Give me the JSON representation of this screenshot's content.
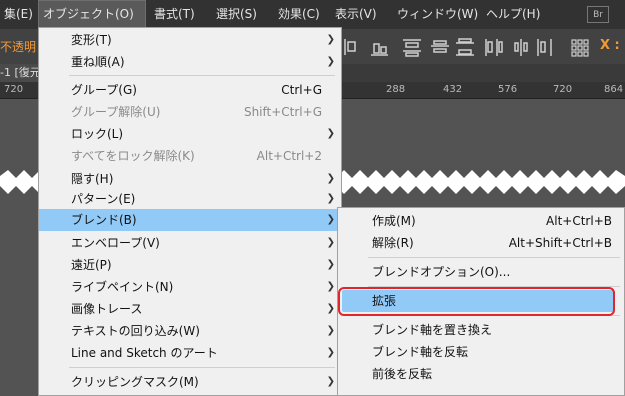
{
  "menubar": {
    "items": [
      {
        "label": "集(E)"
      },
      {
        "label": "オブジェクト(O)"
      },
      {
        "label": "書式(T)"
      },
      {
        "label": "選択(S)"
      },
      {
        "label": "効果(C)"
      },
      {
        "label": "表示(V)"
      },
      {
        "label": "ウィンドウ(W)"
      },
      {
        "label": "ヘルプ(H)"
      }
    ],
    "bridge_label": "Br"
  },
  "toolbar": {
    "opacity_label": "不透明",
    "x_label": "X :"
  },
  "doc_tab": {
    "label": "-1 [復元"
  },
  "ruler": {
    "ticks": [
      "720",
      "288",
      "432",
      "576",
      "720",
      "864"
    ]
  },
  "object_menu": {
    "items": [
      {
        "label": "変形(T)",
        "shortcut": "",
        "submenu": true,
        "disabled": false
      },
      {
        "label": "重ね順(A)",
        "shortcut": "",
        "submenu": true,
        "disabled": false
      },
      {
        "label": "グループ(G)",
        "shortcut": "Ctrl+G",
        "submenu": false,
        "disabled": false
      },
      {
        "label": "グループ解除(U)",
        "shortcut": "Shift+Ctrl+G",
        "submenu": false,
        "disabled": true
      },
      {
        "label": "ロック(L)",
        "shortcut": "",
        "submenu": true,
        "disabled": false
      },
      {
        "label": "すべてをロック解除(K)",
        "shortcut": "Alt+Ctrl+2",
        "submenu": false,
        "disabled": true
      },
      {
        "label": "隠す(H)",
        "shortcut": "",
        "submenu": true,
        "disabled": false
      },
      {
        "label": "パターン(E)",
        "shortcut": "",
        "submenu": true,
        "disabled": false
      },
      {
        "label": "ブレンド(B)",
        "shortcut": "",
        "submenu": true,
        "disabled": false
      },
      {
        "label": "エンベロープ(V)",
        "shortcut": "",
        "submenu": true,
        "disabled": false
      },
      {
        "label": "遠近(P)",
        "shortcut": "",
        "submenu": true,
        "disabled": false
      },
      {
        "label": "ライブペイント(N)",
        "shortcut": "",
        "submenu": true,
        "disabled": false
      },
      {
        "label": "画像トレース",
        "shortcut": "",
        "submenu": true,
        "disabled": false
      },
      {
        "label": "テキストの回り込み(W)",
        "shortcut": "",
        "submenu": true,
        "disabled": false
      },
      {
        "label": "Line and Sketch のアート",
        "shortcut": "",
        "submenu": true,
        "disabled": false
      },
      {
        "label": "クリッピングマスク(M)",
        "shortcut": "",
        "submenu": true,
        "disabled": false
      }
    ]
  },
  "blend_submenu": {
    "items": [
      {
        "label": "作成(M)",
        "shortcut": "Alt+Ctrl+B"
      },
      {
        "label": "解除(R)",
        "shortcut": "Alt+Shift+Ctrl+B"
      },
      {
        "label": "ブレンドオプション(O)...",
        "shortcut": ""
      },
      {
        "label": "拡張",
        "shortcut": ""
      },
      {
        "label": "ブレンド軸を置き換え",
        "shortcut": ""
      },
      {
        "label": "ブレンド軸を反転",
        "shortcut": ""
      },
      {
        "label": "前後を反転",
        "shortcut": ""
      }
    ]
  },
  "colors": {
    "menubar_bg": "#323232",
    "menu_bg": "#f0f0f0",
    "highlight": "#91c9f7",
    "annotation": "#e0252b",
    "toolbar_accent": "#f39a36"
  }
}
